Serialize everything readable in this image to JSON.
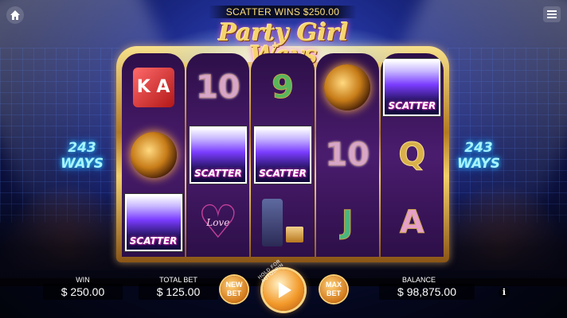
{
  "scatter_banner": "SCATTER WINS $250.00",
  "logo": {
    "line1": "Party Girl",
    "line2": "Ways"
  },
  "ways_left": {
    "num": "243",
    "label": "WAYS"
  },
  "ways_right": {
    "num": "243",
    "label": "WAYS"
  },
  "reels": [
    [
      {
        "type": "dice",
        "text": "K A"
      },
      {
        "type": "disco"
      },
      {
        "type": "scatter",
        "label": "SCATTER"
      }
    ],
    [
      {
        "type": "text",
        "cls": "sym-10",
        "text": "10"
      },
      {
        "type": "scatter",
        "label": "SCATTER"
      },
      {
        "type": "heart",
        "text": "Love"
      }
    ],
    [
      {
        "type": "text",
        "cls": "sym-9",
        "text": "9"
      },
      {
        "type": "scatter",
        "label": "SCATTER"
      },
      {
        "type": "bottle"
      }
    ],
    [
      {
        "type": "disco"
      },
      {
        "type": "text",
        "cls": "sym-10",
        "text": "10"
      },
      {
        "type": "text",
        "cls": "sym-J",
        "text": "J"
      }
    ],
    [
      {
        "type": "scatter",
        "label": "SCATTER"
      },
      {
        "type": "text",
        "cls": "sym-Q",
        "text": "Q"
      },
      {
        "type": "text",
        "cls": "sym-A",
        "text": "A"
      }
    ]
  ],
  "win": {
    "label": "WIN",
    "value": "$ 250.00"
  },
  "total_bet": {
    "label": "TOTAL BET",
    "value": "$ 125.00"
  },
  "new_bet": {
    "line1": "NEW",
    "line2": "BET"
  },
  "max_bet": {
    "line1": "MAX",
    "line2": "BET"
  },
  "spin_hint": "HOLD FOR AUTOSPIN",
  "balance": {
    "label": "BALANCE",
    "value": "$ 98,875.00"
  },
  "info": "i"
}
